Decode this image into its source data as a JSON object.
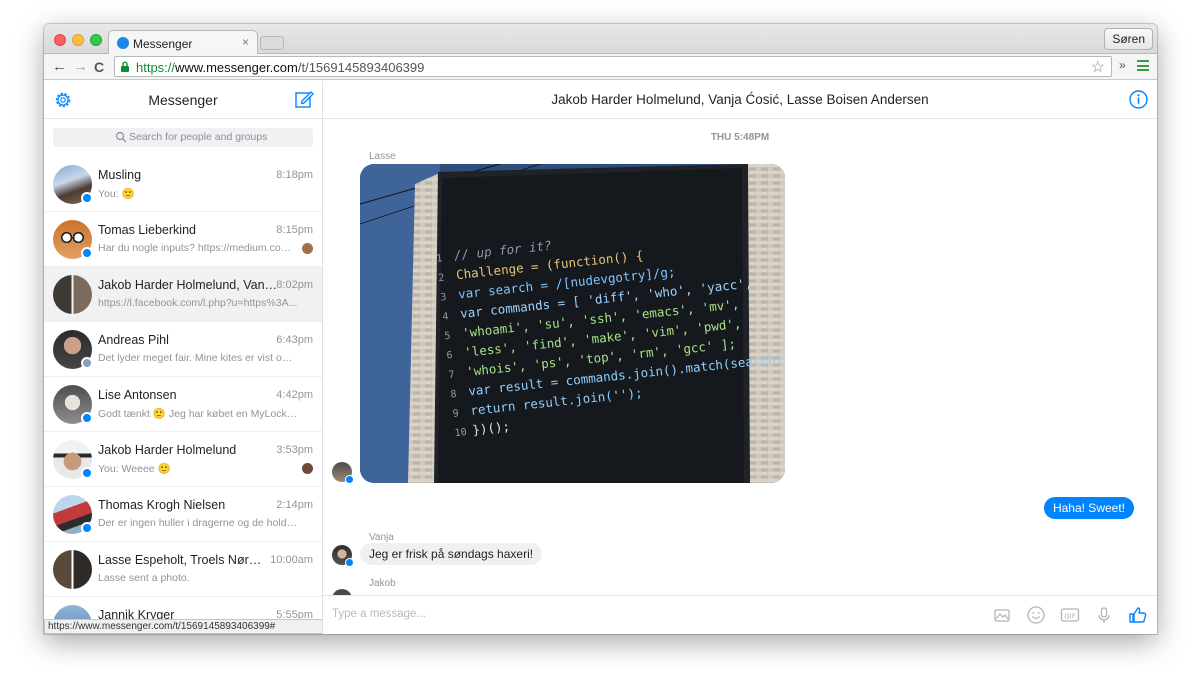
{
  "browser": {
    "tab_title": "Messenger",
    "tab_close": "×",
    "profile_button": "Søren",
    "url_scheme": "https://",
    "url_host": "www.messenger.com",
    "url_path": "/t/1569145893406399",
    "status_url": "https://www.messenger.com/t/1569145893406399#",
    "back_glyph": "←",
    "forward_glyph": "→",
    "reload_glyph": "C",
    "star_glyph": "☆",
    "ext_glyph": "»"
  },
  "sidebar": {
    "title": "Messenger",
    "search_placeholder": "Search for people and groups",
    "conversations": [
      {
        "name": "Musling",
        "time": "8:18pm",
        "snippet": "You: 🙂",
        "badge": "messenger"
      },
      {
        "name": "Tomas Lieberkind",
        "time": "8:15pm",
        "snippet": "Har du nogle inputs? https://medium.com...",
        "badge": "messenger"
      },
      {
        "name": "Jakob Harder Holmelund, Vanja ...",
        "time": "8:02pm",
        "snippet": "https://l.facebook.com/l.php?u=https%3A...",
        "badge": "none",
        "active": true
      },
      {
        "name": "Andreas Pihl",
        "time": "6:43pm",
        "snippet": "Det lyder meget fair. Mine kites er vist ogs...",
        "badge": "facebook"
      },
      {
        "name": "Lise Antonsen",
        "time": "4:42pm",
        "snippet": "Godt tænkt 🙂 Jeg har købet en MyLock 🙂",
        "badge": "messenger"
      },
      {
        "name": "Jakob Harder Holmelund",
        "time": "3:53pm",
        "snippet": "You: Weeee 🙂",
        "badge": "messenger"
      },
      {
        "name": "Thomas Krogh Nielsen",
        "time": "2:14pm",
        "snippet": "Der er ingen huller i dragerne og de holde...",
        "badge": "messenger"
      },
      {
        "name": "Lasse Espeholt, Troels Nørgaard",
        "time": "10:00am",
        "snippet": "Lasse sent a photo.",
        "badge": "none"
      },
      {
        "name": "Jannik Kryger",
        "time": "5:55pm",
        "snippet": "",
        "badge": "none"
      }
    ]
  },
  "thread": {
    "title": "Jakob Harder Holmelund, Vanja Ćosić, Lasse Boisen Andersen",
    "timestamp": "THU 5:48PM",
    "messages": [
      {
        "sender": "Lasse",
        "type": "photo"
      },
      {
        "sender": "You",
        "type": "text",
        "text": "Haha! Sweet!"
      },
      {
        "sender": "Vanja",
        "type": "text",
        "text": "Jeg er frisk på søndags haxeri!"
      },
      {
        "sender": "Jakob",
        "type": "text",
        "text": ""
      }
    ],
    "composer_placeholder": "Type a message..."
  },
  "photo_code": {
    "line_numbers": [
      "1",
      "2",
      "3",
      "4",
      "5",
      "6",
      "7",
      "8",
      "9",
      "10"
    ],
    "lines": [
      "// up for it?",
      "Challenge = (function() {",
      "  var search = /[nudevgotry]/g;",
      "  var commands = [ 'diff', 'who', 'yacc',",
      "    'whoami', 'su', 'ssh', 'emacs', 'mv',",
      "    'less', 'find', 'make', 'vim', 'pwd',",
      "    'whois', 'ps', 'top', 'rm', 'gcc' ];",
      "  var result = commands.join().match(search);",
      "  return result.join('');",
      "})();"
    ]
  },
  "colors": {
    "accent": "#0084ff",
    "secure_green": "#138a36",
    "active_row": "#f1f1f1"
  }
}
